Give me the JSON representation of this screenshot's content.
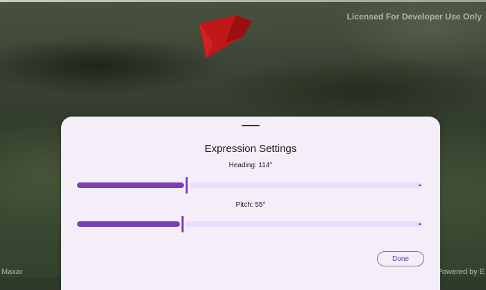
{
  "map": {
    "attribution_top": "Licensed For Developer Use Only",
    "attribution_bottom_left": "Maxar",
    "attribution_bottom_right": "Powered by E",
    "graphic_color": "#b01515"
  },
  "sheet": {
    "title": "Expression Settings",
    "heading": {
      "label": "Heading: 114°",
      "value": 114,
      "min": 0,
      "max": 360
    },
    "pitch": {
      "label": "Pitch: 55°",
      "value": 55,
      "min": 0,
      "max": 180
    },
    "done_label": "Done",
    "accent_color": "#7a3fb8"
  }
}
